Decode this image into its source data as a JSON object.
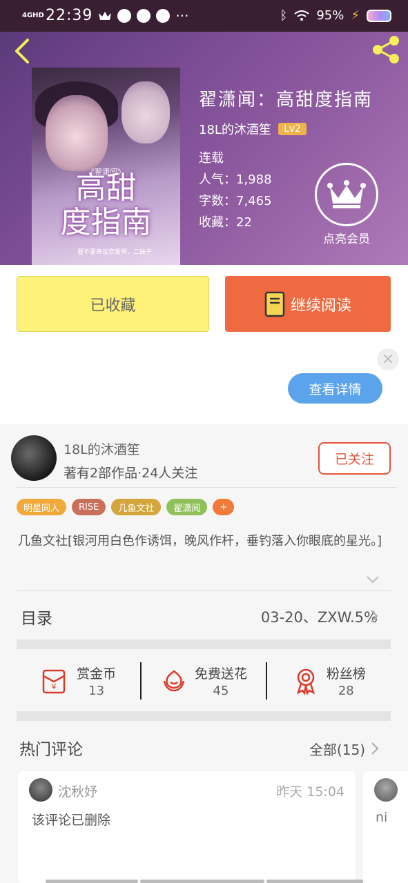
{
  "status_bar": {
    "network": "4GHD",
    "time": "22:39",
    "battery": "95%"
  },
  "book": {
    "title": "翟潇闻：高甜度指南",
    "author": "18L的沐酒笙",
    "level": "Lv2",
    "status": "连载",
    "popularity": "人气：1,988",
    "word_count": "字数：7,465",
    "favorites": "收藏：22",
    "vip_label": "点亮会员",
    "cover": {
      "subtitle": "《翟潇闻》",
      "title_line1": "高甜",
      "title_line2": "度指南",
      "tagline": "要不要来谈恋爱啊，二妹子"
    }
  },
  "actions": {
    "collect_label": "已收藏",
    "read_label": "继续阅读"
  },
  "ad": {
    "detail_label": "查看详情",
    "close_glyph": "×"
  },
  "author_card": {
    "name": "18L的沐酒笙",
    "stats": "著有2部作品·24人关注",
    "follow_label": "已关注",
    "tags": [
      {
        "label": "明星同人",
        "color": "#f2a93b"
      },
      {
        "label": "RISE",
        "color": "#c9705a"
      },
      {
        "label": "几鱼文社",
        "color": "#d4a53a"
      },
      {
        "label": "翟潇闻",
        "color": "#8fc05a"
      },
      {
        "label": "+",
        "color": "#f07a3a"
      }
    ],
    "description": "几鱼文社[银河用白色作诱饵，晚风作杆，垂钓落入你眼底的星光。]"
  },
  "toc": {
    "label": "目录",
    "latest": "03-20、ZXW.5%"
  },
  "support": [
    {
      "label": "赏金币",
      "count": "13",
      "icon": "red-envelope-icon"
    },
    {
      "label": "免费送花",
      "count": "45",
      "icon": "flower-icon"
    },
    {
      "label": "粉丝榜",
      "count": "28",
      "icon": "medal-icon"
    }
  ],
  "hot_comments": {
    "title": "热门评论",
    "all_label": "全部(15)",
    "items": [
      {
        "user": "沈秋妤",
        "time": "昨天 15:04",
        "text": "该评论已删除"
      },
      {
        "user": "ni"
      }
    ]
  },
  "colors": {
    "accent": "#ef6a40",
    "collect": "#fff27a",
    "follow": "#e2543a",
    "detail": "#5ba3ea"
  }
}
